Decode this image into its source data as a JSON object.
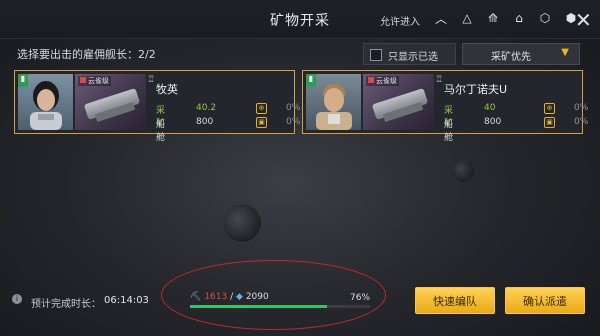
{
  "header": {
    "title": "矿物开采",
    "allow_label": "允许进入",
    "tier_icons": [
      "chevron-up-icon",
      "tier-1-icon",
      "tier-2-icon",
      "tier-3-icon",
      "tier-4-icon",
      "tier-5-icon"
    ]
  },
  "selection": {
    "label": "选择要出击的雇佣舰长：2/2",
    "filter_label": "只显示已选",
    "sort_label": "采矿优先"
  },
  "captains": [
    {
      "name": "牧英",
      "ship_class": "云雀级",
      "mining_label": "采矿",
      "mining_value": "40.2",
      "mining_pct": "0%",
      "hold_label": "船舱",
      "hold_value": "800",
      "hold_pct": "0%"
    },
    {
      "name": "马尔丁诺夫U",
      "ship_class": "云雀级",
      "mining_label": "采矿",
      "mining_value": "40",
      "mining_pct": "0%",
      "hold_label": "船舱",
      "hold_value": "800",
      "hold_pct": "0%"
    }
  ],
  "footer": {
    "eta_label": "预计完成时长：",
    "eta_value": "06:14:03",
    "cargo_current": "1613",
    "cargo_sep": "/",
    "cargo_capacity": "2090",
    "progress_pct": "76%",
    "progress_fraction": 0.76,
    "quick_button": "快速编队",
    "confirm_button": "确认派遣"
  },
  "colors": {
    "accent": "#f2b41c",
    "card_border": "#d8a23a",
    "highlight_ring": "#c0282d",
    "progress": "#35c468"
  }
}
